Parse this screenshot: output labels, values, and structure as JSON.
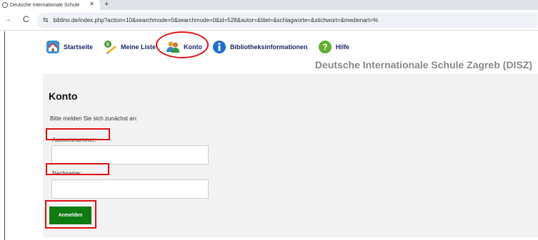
{
  "browser": {
    "tab_title": "Deutsche Internationale Schule",
    "tab_close": "✕",
    "new_tab": "+",
    "url": "biblino.de/index.php?action=10&searchmode=0&searchmode=0&id=528&autor=&titel=&schlagworte=&stichwort=&medienart=%",
    "nav_forward": "→",
    "nav_reload": "C",
    "site_info": "⇆"
  },
  "menu": {
    "items": [
      {
        "label": "Startseite",
        "icon": "home-icon"
      },
      {
        "label": "Meine Liste",
        "icon": "list-icon"
      },
      {
        "label": "Konto",
        "icon": "account-icon"
      },
      {
        "label": "Bibliotheksinformationen",
        "icon": "info-icon"
      },
      {
        "label": "Hilfe",
        "icon": "help-icon"
      }
    ]
  },
  "site_title": "Deutsche Internationale Schule Zagreb (DISZ)",
  "panel": {
    "title": "Konto",
    "intro": "Bitte melden Sie sich zunächst an:",
    "fields": [
      {
        "label": "Ausweisnummer:",
        "value": ""
      },
      {
        "label": "Nachname:",
        "value": ""
      }
    ],
    "submit_label": "Anmelden"
  },
  "colors": {
    "menu_text": "#1b2a6b",
    "submit_bg": "#0e7a12",
    "annotation": "#e01010",
    "panel_bg": "#f2f2f2"
  }
}
